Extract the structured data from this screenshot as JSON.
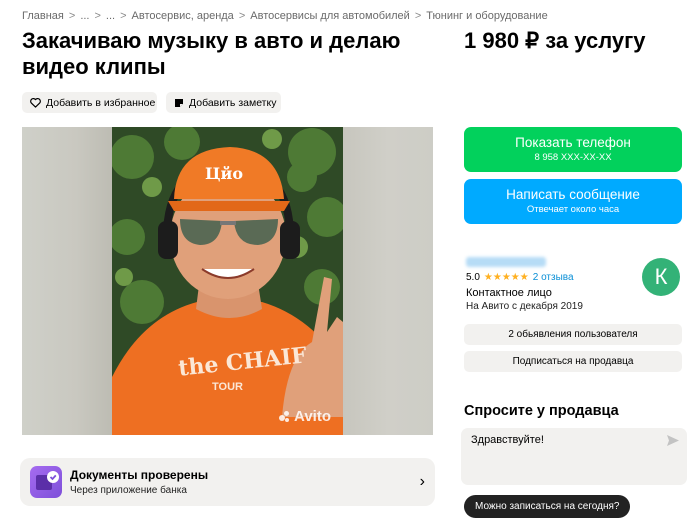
{
  "breadcrumb": [
    {
      "label": "Главная"
    },
    {
      "label": "..."
    },
    {
      "label": "..."
    },
    {
      "label": "Автосервис, аренда"
    },
    {
      "label": "Автосервисы для автомобилей"
    },
    {
      "label": "Тюнинг и оборудование"
    }
  ],
  "breadcrumb_separator": ">",
  "listing": {
    "title": "Закачиваю музыку в авто и делаю видео клипы",
    "price": "1 980 ₽ за услугу"
  },
  "actions": {
    "favorite_label": "Добавить в избранное",
    "note_label": "Добавить заметку"
  },
  "gallery": {
    "watermark": "Avito",
    "cap_text": "Цйо",
    "shirt_text": "the CHAIF",
    "shirt_subtext": "TOUR"
  },
  "docs": {
    "title": "Документы проверены",
    "subtitle": "Через приложение банка"
  },
  "contact": {
    "phone_label": "Показать телефон",
    "phone_number": "8 958 XXX-XX-XX",
    "message_label": "Написать сообщение",
    "message_sub": "Отвечает около часа"
  },
  "seller": {
    "rating": "5.0",
    "stars": "★★★★★",
    "reviews": "2 отзыва",
    "role": "Контактное лицо",
    "since": "На Авито с декабря 2019",
    "avatar_letter": "К",
    "ads_label": "2 обьявления пользователя",
    "subscribe_label": "Подписаться на продавца"
  },
  "ask": {
    "title": "Спросите у продавца",
    "message_value": "Здравствуйте!",
    "quick_reply": "Можно записаться на сегодня?"
  },
  "colors": {
    "green": "#02d15c",
    "blue": "#00aaff",
    "avatar": "#33b277",
    "star": "#ffb021",
    "link": "#0a8fd6",
    "grey_bg": "#f2f1ef"
  },
  "icons": {
    "favorite": "heart-icon",
    "note": "note-icon",
    "docs": "verified-docs-icon",
    "send": "send-icon",
    "chevron": "chevron-right-icon"
  }
}
